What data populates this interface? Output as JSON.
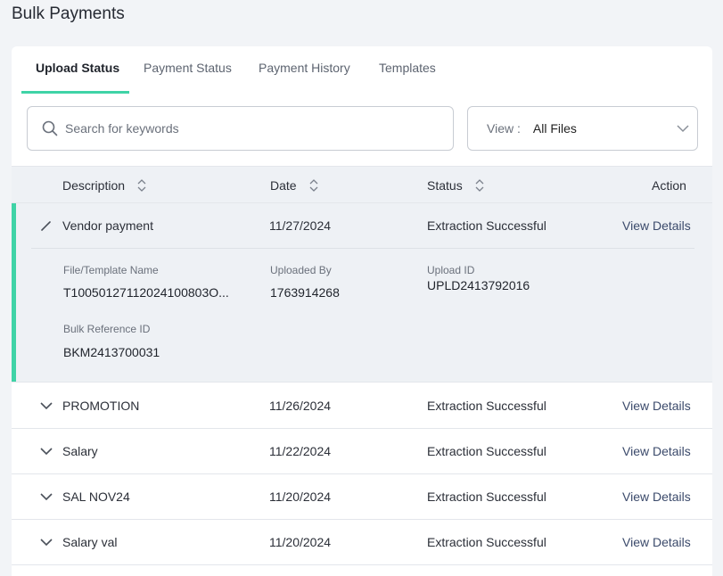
{
  "page": {
    "title": "Bulk Payments"
  },
  "tabs": [
    {
      "label": "Upload Status",
      "active": true
    },
    {
      "label": "Payment Status",
      "active": false
    },
    {
      "label": "Payment History",
      "active": false
    },
    {
      "label": "Templates",
      "active": false
    }
  ],
  "search": {
    "placeholder": "Search for keywords",
    "value": ""
  },
  "view": {
    "label": "View :",
    "selected": "All Files"
  },
  "table": {
    "columns": {
      "description": "Description",
      "date": "Date",
      "status": "Status",
      "action": "Action"
    },
    "expanded_row": {
      "description": "Vendor payment",
      "date": "11/27/2024",
      "status": "Extraction Successful",
      "action": "View Details",
      "details": {
        "file_label": "File/Template Name",
        "file_value": "T10050127112024100803O...",
        "uploaded_by_label": "Uploaded By",
        "uploaded_by_value": "1763914268",
        "upload_id_label": "Upload ID",
        "upload_id_value": "UPLD2413792016",
        "bulk_ref_label": "Bulk Reference ID",
        "bulk_ref_value": "BKM2413700031"
      }
    },
    "rows": [
      {
        "description": "PROMOTION",
        "date": "11/26/2024",
        "status": "Extraction Successful",
        "action": "View Details"
      },
      {
        "description": "Salary",
        "date": "11/22/2024",
        "status": "Extraction Successful",
        "action": "View Details"
      },
      {
        "description": "SAL NOV24",
        "date": "11/20/2024",
        "status": "Extraction Successful",
        "action": "View Details"
      },
      {
        "description": "Salary val",
        "date": "11/20/2024",
        "status": "Extraction Successful",
        "action": "View Details"
      }
    ]
  },
  "colors": {
    "accent": "#3fd3a6",
    "link": "#3b4a6b",
    "header_bg": "#eef1f5"
  }
}
